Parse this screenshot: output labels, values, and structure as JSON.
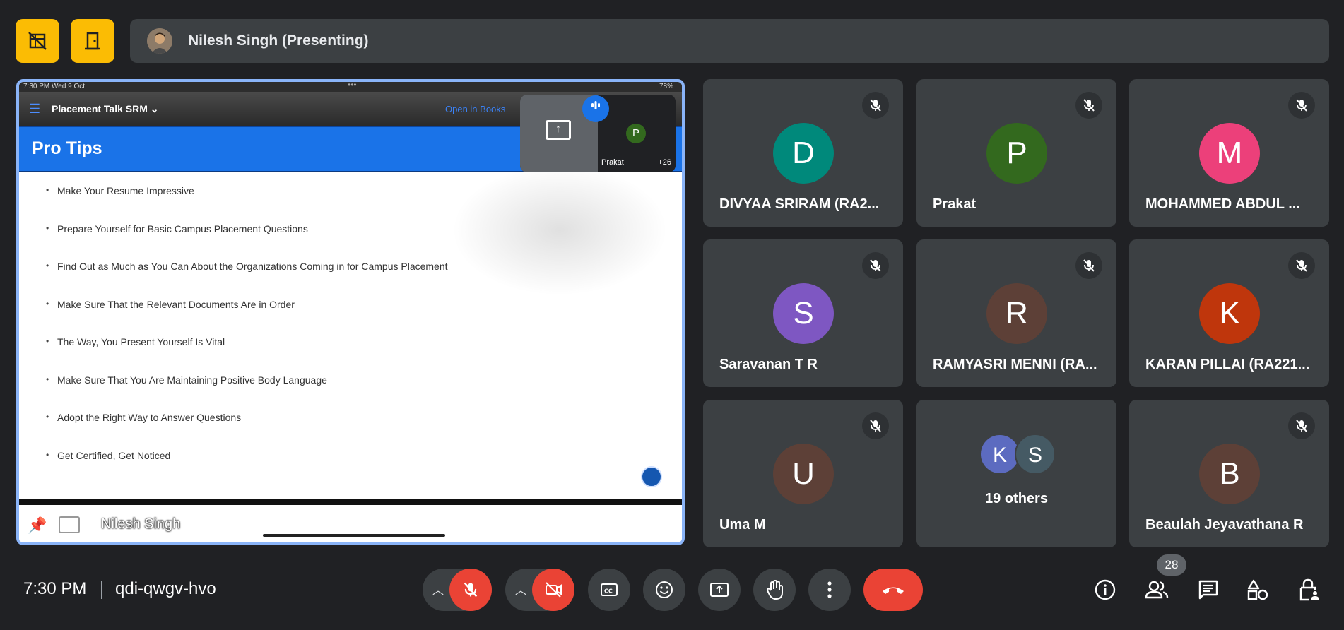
{
  "header": {
    "presenter_label": "Nilesh Singh (Presenting)"
  },
  "shared_screen": {
    "status_time": "7:30 PM   Wed 9 Oct",
    "status_dots": "•••",
    "battery": "78%",
    "book_title": "Placement Talk SRM",
    "open_in_books": "Open in Books",
    "section_title": "Pro Tips",
    "tips": [
      "Make Your Resume Impressive",
      "Prepare Yourself for Basic Campus Placement Questions",
      " Find Out as Much as You Can About the Organizations Coming in for Campus Placement",
      "Make Sure That the Relevant Documents Are in Order",
      "The Way, You Present Yourself Is Vital",
      "Make Sure That You Are Maintaining Positive Body Language",
      "Adopt the Right Way to Answer Questions",
      "Get Certified, Get Noticed"
    ],
    "pip": {
      "name": "Prakat",
      "initial": "P",
      "extra_count": "+26"
    },
    "owner_name": "Nilesh Singh"
  },
  "participants": [
    {
      "initial": "D",
      "name": "DIVYAA SRIRAM (RA2...",
      "color": "#00897b"
    },
    {
      "initial": "P",
      "name": "Prakat",
      "color": "#33691e"
    },
    {
      "initial": "M",
      "name": "MOHAMMED ABDUL ...",
      "color": "#ec407a"
    },
    {
      "initial": "S",
      "name": "Saravanan T R",
      "color": "#7e57c2"
    },
    {
      "initial": "R",
      "name": "RAMYASRI MENNI (RA...",
      "color": "#5d4037"
    },
    {
      "initial": "K",
      "name": "KARAN PILLAI (RA221...",
      "color": "#bf360c"
    },
    {
      "initial": "U",
      "name": "Uma M",
      "color": "#5d4037"
    },
    {
      "initial": "B",
      "name": "Beaulah Jeyavathana R",
      "color": "#5d4037"
    }
  ],
  "others_tile": {
    "initials": [
      "K",
      "S"
    ],
    "colors": [
      "#5c6bc0",
      "#455a64"
    ],
    "label": "19 others"
  },
  "footer": {
    "time": "7:30 PM",
    "meeting_code": "qdi-qwgv-hvo",
    "participant_count": "28"
  },
  "colors": {
    "background": "#202124",
    "tile": "#3c4043",
    "accent_yellow": "#fbbc04",
    "danger_red": "#ea4335",
    "share_border": "#8ab4f8"
  }
}
